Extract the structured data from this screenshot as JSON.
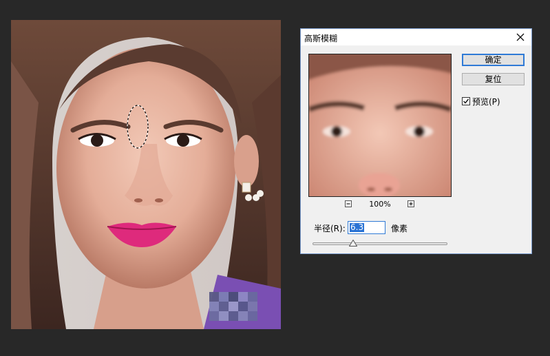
{
  "dialog": {
    "title": "高斯模糊",
    "ok_label": "确定",
    "reset_label": "复位",
    "preview_label": "预览(P)",
    "preview_checked": true,
    "zoom_value": "100%",
    "radius_label": "半径(R):",
    "radius_value": "6.3",
    "unit_label": "像素",
    "radius_slider_fraction": 0.3,
    "close_icon": "close-icon",
    "zoom_out_icon": "minus-icon",
    "zoom_in_icon": "plus-icon"
  },
  "colors": {
    "workspace_bg": "#282828",
    "dialog_bg": "#f0f0f0",
    "accent": "#2f7ad6",
    "selection": "#2a73d4"
  }
}
